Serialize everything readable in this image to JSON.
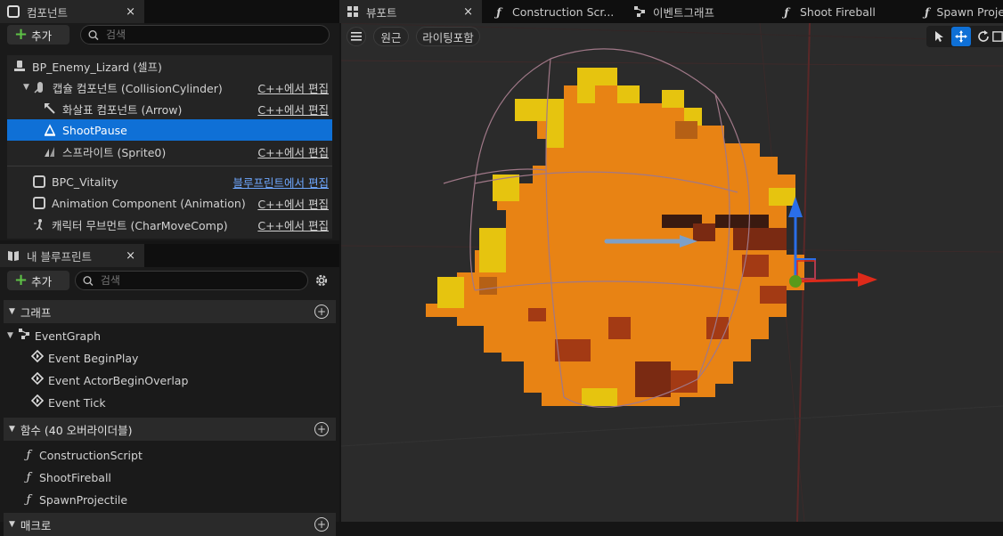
{
  "components_tab": {
    "label": "컴포넌트",
    "close": "×"
  },
  "components_toolbar": {
    "add_label": "추가",
    "search_placeholder": "검색"
  },
  "components": [
    {
      "label": "BP_Enemy_Lizard (셀프)",
      "link": ""
    },
    {
      "label": "캡슐 컴포넌트 (CollisionCylinder)",
      "link": "C++에서 편집"
    },
    {
      "label": "화살표 컴포넌트 (Arrow)",
      "link": "C++에서 편집"
    },
    {
      "label": "ShootPause",
      "link": ""
    },
    {
      "label": "스프라이트 (Sprite0)",
      "link": "C++에서 편집"
    },
    {
      "label": "BPC_Vitality",
      "link": "블루프린트에서 편집"
    },
    {
      "label": "Animation Component (Animation)",
      "link": "C++에서 편집"
    },
    {
      "label": "캐릭터 무브먼트 (CharMoveComp)",
      "link": "C++에서 편집"
    }
  ],
  "blueprint_tab": {
    "label": "내 블루프린트",
    "close": "×"
  },
  "blueprint_toolbar": {
    "add_label": "추가",
    "search_placeholder": "검색"
  },
  "graph_section": {
    "label": "그래프"
  },
  "graph_items": [
    {
      "label": "EventGraph"
    },
    {
      "label": "Event BeginPlay"
    },
    {
      "label": "Event ActorBeginOverlap"
    },
    {
      "label": "Event Tick"
    }
  ],
  "functions_section": {
    "label": "함수 (40 오버라이더블)"
  },
  "function_items": [
    {
      "label": "ConstructionScript"
    },
    {
      "label": "ShootFireball"
    },
    {
      "label": "SpawnProjectile"
    }
  ],
  "macro_section": {
    "label": "매크로"
  },
  "top_tabs": [
    {
      "label": "뷰포트",
      "close": "×"
    },
    {
      "label": "Construction Scr..."
    },
    {
      "label": "이벤트그래프"
    },
    {
      "label": "Shoot Fireball"
    },
    {
      "label": "Spawn Proje"
    }
  ],
  "viewport_toolbar": {
    "perspective": "원근",
    "lighting": "라이팅포함"
  },
  "colors": {
    "accent": "#0f70d6",
    "link_blue": "#6fa8ff",
    "add_green": "#5ec246"
  },
  "icons": [
    "component-icon",
    "hamburger-icon",
    "select-icon",
    "move-icon",
    "rotate-icon",
    "gear-icon",
    "function-icon",
    "event-icon"
  ]
}
